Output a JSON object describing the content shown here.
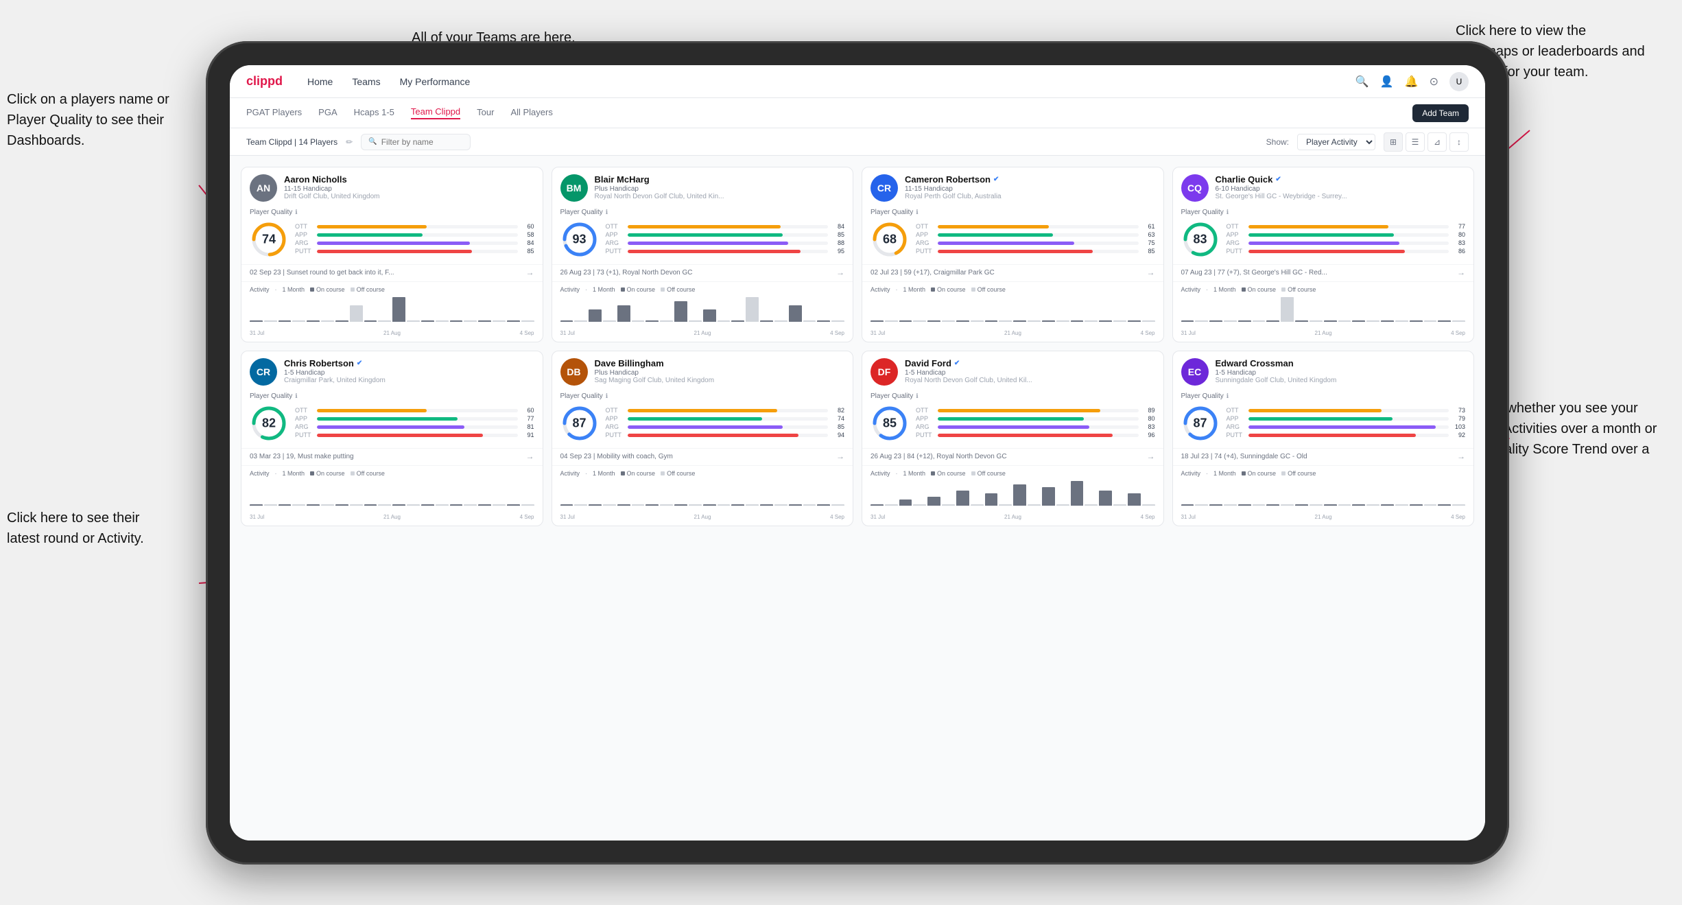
{
  "annotations": {
    "top_teams": "All of your Teams are here.",
    "top_right": "Click here to view the\nHeatmaps or leaderboards\nand streaks for your team.",
    "left_top": "Click on a players name\nor Player Quality to see\ntheir Dashboards.",
    "left_bottom": "Click here to see their latest\nround or Activity.",
    "right_bottom": "Choose whether you see\nyour players Activities over\na month or their Quality\nScore Trend over a year."
  },
  "nav": {
    "logo": "clippd",
    "items": [
      "Home",
      "Teams",
      "My Performance"
    ],
    "add_team": "Add Team"
  },
  "sub_nav": {
    "items": [
      "PGAT Players",
      "PGA",
      "Hcaps 1-5",
      "Team Clippd",
      "Tour",
      "All Players"
    ],
    "active": "Team Clippd"
  },
  "toolbar": {
    "team_label": "Team Clippd | 14 Players",
    "search_placeholder": "Filter by name",
    "show_label": "Show:",
    "show_option": "Player Activity",
    "filter_icon": "⊞",
    "add_team_label": "Add Team"
  },
  "players": [
    {
      "name": "Aaron Nicholls",
      "handicap": "11-15 Handicap",
      "club": "Drift Golf Club, United Kingdom",
      "quality": 74,
      "quality_pct": 74,
      "stats": [
        {
          "label": "OTT",
          "value": 60,
          "color": "#f59e0b"
        },
        {
          "label": "APP",
          "value": 58,
          "color": "#10b981"
        },
        {
          "label": "ARG",
          "value": 84,
          "color": "#8b5cf6"
        },
        {
          "label": "PUTT",
          "value": 85,
          "color": "#ef4444"
        }
      ],
      "recent": "02 Sep 23 | Sunset round to get back into it, F...",
      "activity_bars": [
        0,
        0,
        0,
        0,
        0,
        0,
        0,
        2,
        0,
        0,
        3,
        0,
        0,
        0,
        0,
        0,
        0,
        0,
        0,
        0
      ],
      "chart_labels": [
        "31 Jul",
        "21 Aug",
        "4 Sep"
      ],
      "initials": "AN",
      "avatar_color": "#6b7280"
    },
    {
      "name": "Blair McHarg",
      "handicap": "Plus Handicap",
      "club": "Royal North Devon Golf Club, United Kin...",
      "quality": 93,
      "quality_pct": 93,
      "stats": [
        {
          "label": "OTT",
          "value": 84,
          "color": "#f59e0b"
        },
        {
          "label": "APP",
          "value": 85,
          "color": "#10b981"
        },
        {
          "label": "ARG",
          "value": 88,
          "color": "#8b5cf6"
        },
        {
          "label": "PUTT",
          "value": 95,
          "color": "#ef4444"
        }
      ],
      "recent": "26 Aug 23 | 73 (+1), Royal North Devon GC",
      "activity_bars": [
        0,
        0,
        3,
        0,
        4,
        0,
        0,
        0,
        5,
        0,
        3,
        0,
        0,
        6,
        0,
        0,
        4,
        0,
        0,
        0
      ],
      "chart_labels": [
        "31 Jul",
        "21 Aug",
        "4 Sep"
      ],
      "initials": "BM",
      "avatar_color": "#059669"
    },
    {
      "name": "Cameron Robertson",
      "handicap": "11-15 Handicap",
      "club": "Royal Perth Golf Club, Australia",
      "quality": 68,
      "quality_pct": 68,
      "stats": [
        {
          "label": "OTT",
          "value": 61,
          "color": "#f59e0b"
        },
        {
          "label": "APP",
          "value": 63,
          "color": "#10b981"
        },
        {
          "label": "ARG",
          "value": 75,
          "color": "#8b5cf6"
        },
        {
          "label": "PUTT",
          "value": 85,
          "color": "#ef4444"
        }
      ],
      "recent": "02 Jul 23 | 59 (+17), Craigmillar Park GC",
      "activity_bars": [
        0,
        0,
        0,
        0,
        0,
        0,
        0,
        0,
        0,
        0,
        0,
        0,
        0,
        0,
        0,
        0,
        0,
        0,
        0,
        0
      ],
      "chart_labels": [
        "31 Jul",
        "21 Aug",
        "4 Sep"
      ],
      "initials": "CR",
      "avatar_color": "#2563eb",
      "verified": true
    },
    {
      "name": "Charlie Quick",
      "handicap": "6-10 Handicap",
      "club": "St. George's Hill GC - Weybridge - Surrey...",
      "quality": 83,
      "quality_pct": 83,
      "stats": [
        {
          "label": "OTT",
          "value": 77,
          "color": "#f59e0b"
        },
        {
          "label": "APP",
          "value": 80,
          "color": "#10b981"
        },
        {
          "label": "ARG",
          "value": 83,
          "color": "#8b5cf6"
        },
        {
          "label": "PUTT",
          "value": 86,
          "color": "#ef4444"
        }
      ],
      "recent": "07 Aug 23 | 77 (+7), St George's Hill GC - Red...",
      "activity_bars": [
        0,
        0,
        0,
        0,
        0,
        0,
        0,
        3,
        0,
        0,
        0,
        0,
        0,
        0,
        0,
        0,
        0,
        0,
        0,
        0
      ],
      "chart_labels": [
        "31 Jul",
        "21 Aug",
        "4 Sep"
      ],
      "initials": "CQ",
      "avatar_color": "#7c3aed",
      "verified": true
    },
    {
      "name": "Chris Robertson",
      "handicap": "1-5 Handicap",
      "club": "Craigmillar Park, United Kingdom",
      "quality": 82,
      "quality_pct": 82,
      "stats": [
        {
          "label": "OTT",
          "value": 60,
          "color": "#f59e0b"
        },
        {
          "label": "APP",
          "value": 77,
          "color": "#10b981"
        },
        {
          "label": "ARG",
          "value": 81,
          "color": "#8b5cf6"
        },
        {
          "label": "PUTT",
          "value": 91,
          "color": "#ef4444"
        }
      ],
      "recent": "03 Mar 23 | 19, Must make putting",
      "activity_bars": [
        0,
        0,
        0,
        0,
        0,
        0,
        0,
        0,
        0,
        0,
        0,
        0,
        0,
        0,
        0,
        0,
        0,
        0,
        0,
        0
      ],
      "chart_labels": [
        "31 Jul",
        "21 Aug",
        "4 Sep"
      ],
      "initials": "CR2",
      "avatar_color": "#0369a1",
      "verified": true
    },
    {
      "name": "Dave Billingham",
      "handicap": "Plus Handicap",
      "club": "Sag Maging Golf Club, United Kingdom",
      "quality": 87,
      "quality_pct": 87,
      "stats": [
        {
          "label": "OTT",
          "value": 82,
          "color": "#f59e0b"
        },
        {
          "label": "APP",
          "value": 74,
          "color": "#10b981"
        },
        {
          "label": "ARG",
          "value": 85,
          "color": "#8b5cf6"
        },
        {
          "label": "PUTT",
          "value": 94,
          "color": "#ef4444"
        }
      ],
      "recent": "04 Sep 23 | Mobility with coach, Gym",
      "activity_bars": [
        0,
        0,
        0,
        0,
        0,
        0,
        0,
        0,
        0,
        0,
        0,
        0,
        0,
        0,
        0,
        0,
        0,
        0,
        0,
        0
      ],
      "chart_labels": [
        "31 Jul",
        "21 Aug",
        "4 Sep"
      ],
      "initials": "DB",
      "avatar_color": "#b45309"
    },
    {
      "name": "David Ford",
      "handicap": "1-5 Handicap",
      "club": "Royal North Devon Golf Club, United Kil...",
      "quality": 85,
      "quality_pct": 85,
      "stats": [
        {
          "label": "OTT",
          "value": 89,
          "color": "#f59e0b"
        },
        {
          "label": "APP",
          "value": 80,
          "color": "#10b981"
        },
        {
          "label": "ARG",
          "value": 83,
          "color": "#8b5cf6"
        },
        {
          "label": "PUTT",
          "value": 96,
          "color": "#ef4444"
        }
      ],
      "recent": "26 Aug 23 | 84 (+12), Royal North Devon GC",
      "activity_bars": [
        0,
        0,
        2,
        0,
        3,
        0,
        5,
        0,
        4,
        0,
        7,
        0,
        6,
        0,
        8,
        0,
        5,
        0,
        4,
        0
      ],
      "chart_labels": [
        "31 Jul",
        "21 Aug",
        "4 Sep"
      ],
      "initials": "DF",
      "avatar_color": "#dc2626",
      "verified": true
    },
    {
      "name": "Edward Crossman",
      "handicap": "1-5 Handicap",
      "club": "Sunningdale Golf Club, United Kingdom",
      "quality": 87,
      "quality_pct": 87,
      "stats": [
        {
          "label": "OTT",
          "value": 73,
          "color": "#f59e0b"
        },
        {
          "label": "APP",
          "value": 79,
          "color": "#10b981"
        },
        {
          "label": "ARG",
          "value": 103,
          "color": "#8b5cf6"
        },
        {
          "label": "PUTT",
          "value": 92,
          "color": "#ef4444"
        }
      ],
      "recent": "18 Jul 23 | 74 (+4), Sunningdale GC - Old",
      "activity_bars": [
        0,
        0,
        0,
        0,
        0,
        0,
        0,
        0,
        0,
        0,
        0,
        0,
        0,
        0,
        0,
        0,
        0,
        0,
        0,
        0
      ],
      "chart_labels": [
        "31 Jul",
        "21 Aug",
        "4 Sep"
      ],
      "initials": "EC",
      "avatar_color": "#6d28d9"
    }
  ],
  "colors": {
    "brand_red": "#e0174a",
    "nav_bg": "#ffffff",
    "card_bg": "#ffffff",
    "grid_bg": "#f9fafb",
    "on_course": "#6b7280",
    "off_course": "#d1d5db"
  }
}
